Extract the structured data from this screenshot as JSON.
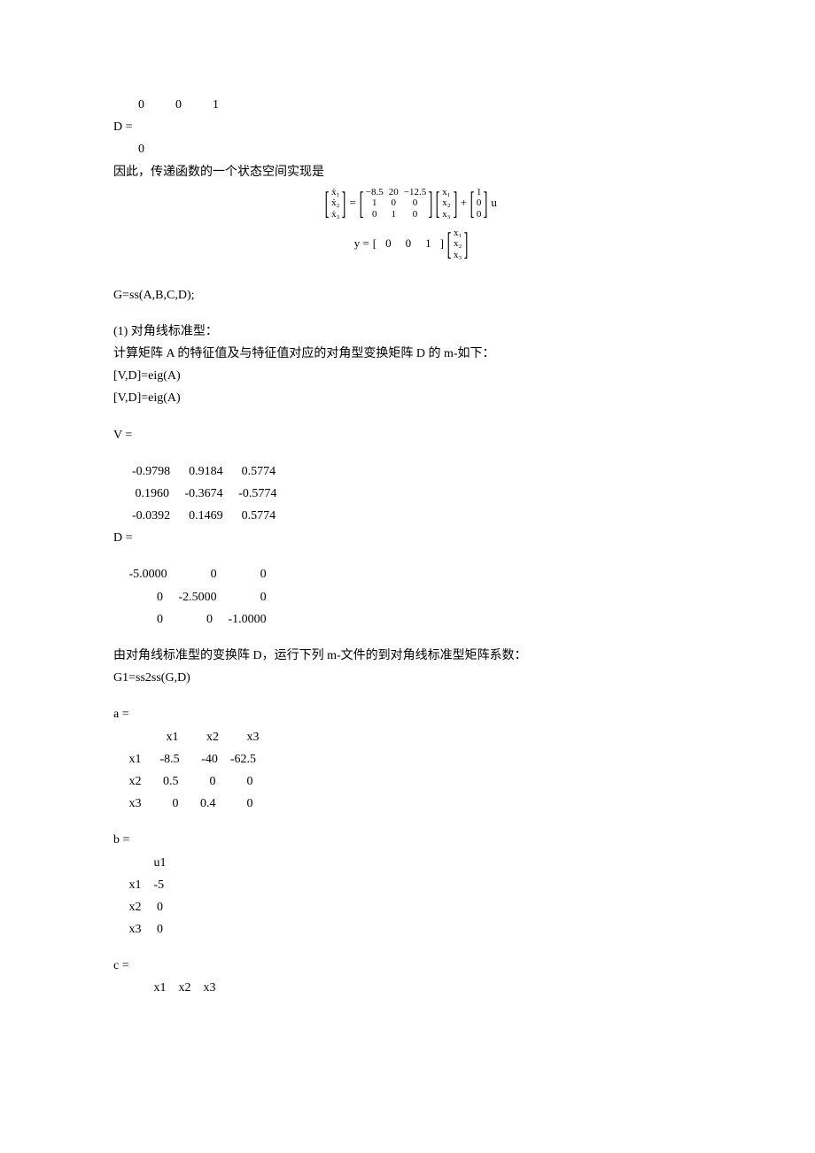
{
  "top_matrix_row": "        0          0          1",
  "D_label": "D =",
  "D_value_row": "        0",
  "therefore_line": "因此，传递函数的一个状态空间实现是",
  "eq1": {
    "lhs_col": [
      "ẋ₁",
      "ẋ₂",
      "ẋ₃"
    ],
    "A_row1": [
      "−8.5",
      "20",
      "−12.5"
    ],
    "A_row2": [
      "1",
      "0",
      "0"
    ],
    "A_row3": [
      "0",
      "1",
      "0"
    ],
    "x_col": [
      "x₁",
      "x₂",
      "x₃"
    ],
    "B_col": [
      "1",
      "0",
      "0"
    ],
    "u": "u",
    "eq_sign": "=",
    "plus": "+"
  },
  "eq2": {
    "y_eq": "y =",
    "row": [
      "0",
      "0",
      "1"
    ],
    "x_col": [
      "x₁",
      "x₂",
      "x₃"
    ]
  },
  "gss_line": " G=ss(A,B,C,D);",
  "section1_title": "(1)  对角线标准型：",
  "section1_desc": "计算矩阵 A 的特征值及与特征值对应的对角型变换矩阵 D 的 m-如下：",
  "eig_line1": " [V,D]=eig(A)",
  "eig_line2": " [V,D]=eig(A)",
  "V_label": "V =",
  "V_rows": [
    "      -0.9798      0.9184      0.5774",
    "       0.1960     -0.3674     -0.5774",
    "      -0.0392      0.1469      0.5774"
  ],
  "D2_label": "D =",
  "D2_rows": [
    "     -5.0000              0              0",
    "              0     -2.5000              0",
    "              0              0     -1.0000"
  ],
  "diag_desc": " 由对角线标准型的变换阵 D，运行下列 m-文件的到对角线标准型矩阵系数：",
  "g1_line": " G1=ss2ss(G,D)",
  "a_label": "a =",
  "a_header": "                 x1         x2         x3",
  "a_rows": [
    "     x1      -8.5       -40    -62.5",
    "     x2       0.5          0          0",
    "     x3          0       0.4          0"
  ],
  "b_label": "b =",
  "b_header": "             u1",
  "b_rows": [
    "     x1    -5",
    "     x2     0",
    "     x3     0"
  ],
  "c_label": "c =",
  "c_header": "             x1    x2    x3"
}
